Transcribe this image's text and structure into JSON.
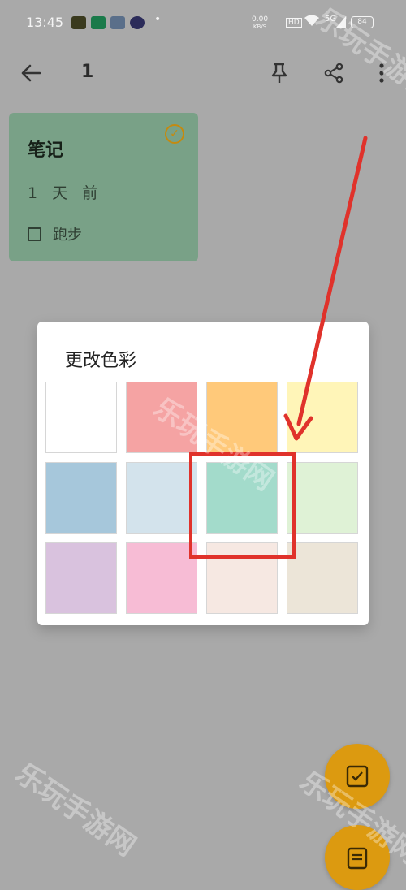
{
  "status_bar": {
    "time": "13:45",
    "net_speed_value": "0.00",
    "net_speed_unit": "KB/S",
    "hd_badge": "HD",
    "signal_label": "5G",
    "battery": "84"
  },
  "toolbar": {
    "title": "1",
    "icons": [
      "back-arrow-icon",
      "pin-icon",
      "share-icon",
      "more-vertical-icon"
    ]
  },
  "note_card": {
    "title": "笔记",
    "time": "1 天 前",
    "item_label": "跑步",
    "color": "#79a187"
  },
  "color_dialog": {
    "title": "更改色彩",
    "selected_index": 6,
    "swatches": [
      "#ffffff",
      "#f5a3a3",
      "#ffc97a",
      "#fff5b8",
      "#a6c7db",
      "#d3e3ec",
      "#a3dbcb",
      "#dff2d6",
      "#d9c2de",
      "#f7bcd5",
      "#f6e8e2",
      "#ece5d8"
    ]
  },
  "watermarks": [
    "乐玩手游网",
    "乐玩手游网",
    "乐玩手游网",
    "乐玩手游网"
  ],
  "fabs": [
    "checklist-fab-icon",
    "note-fab-icon"
  ],
  "accent_color": "#dc9a10",
  "annotation_color": "#e0322b"
}
